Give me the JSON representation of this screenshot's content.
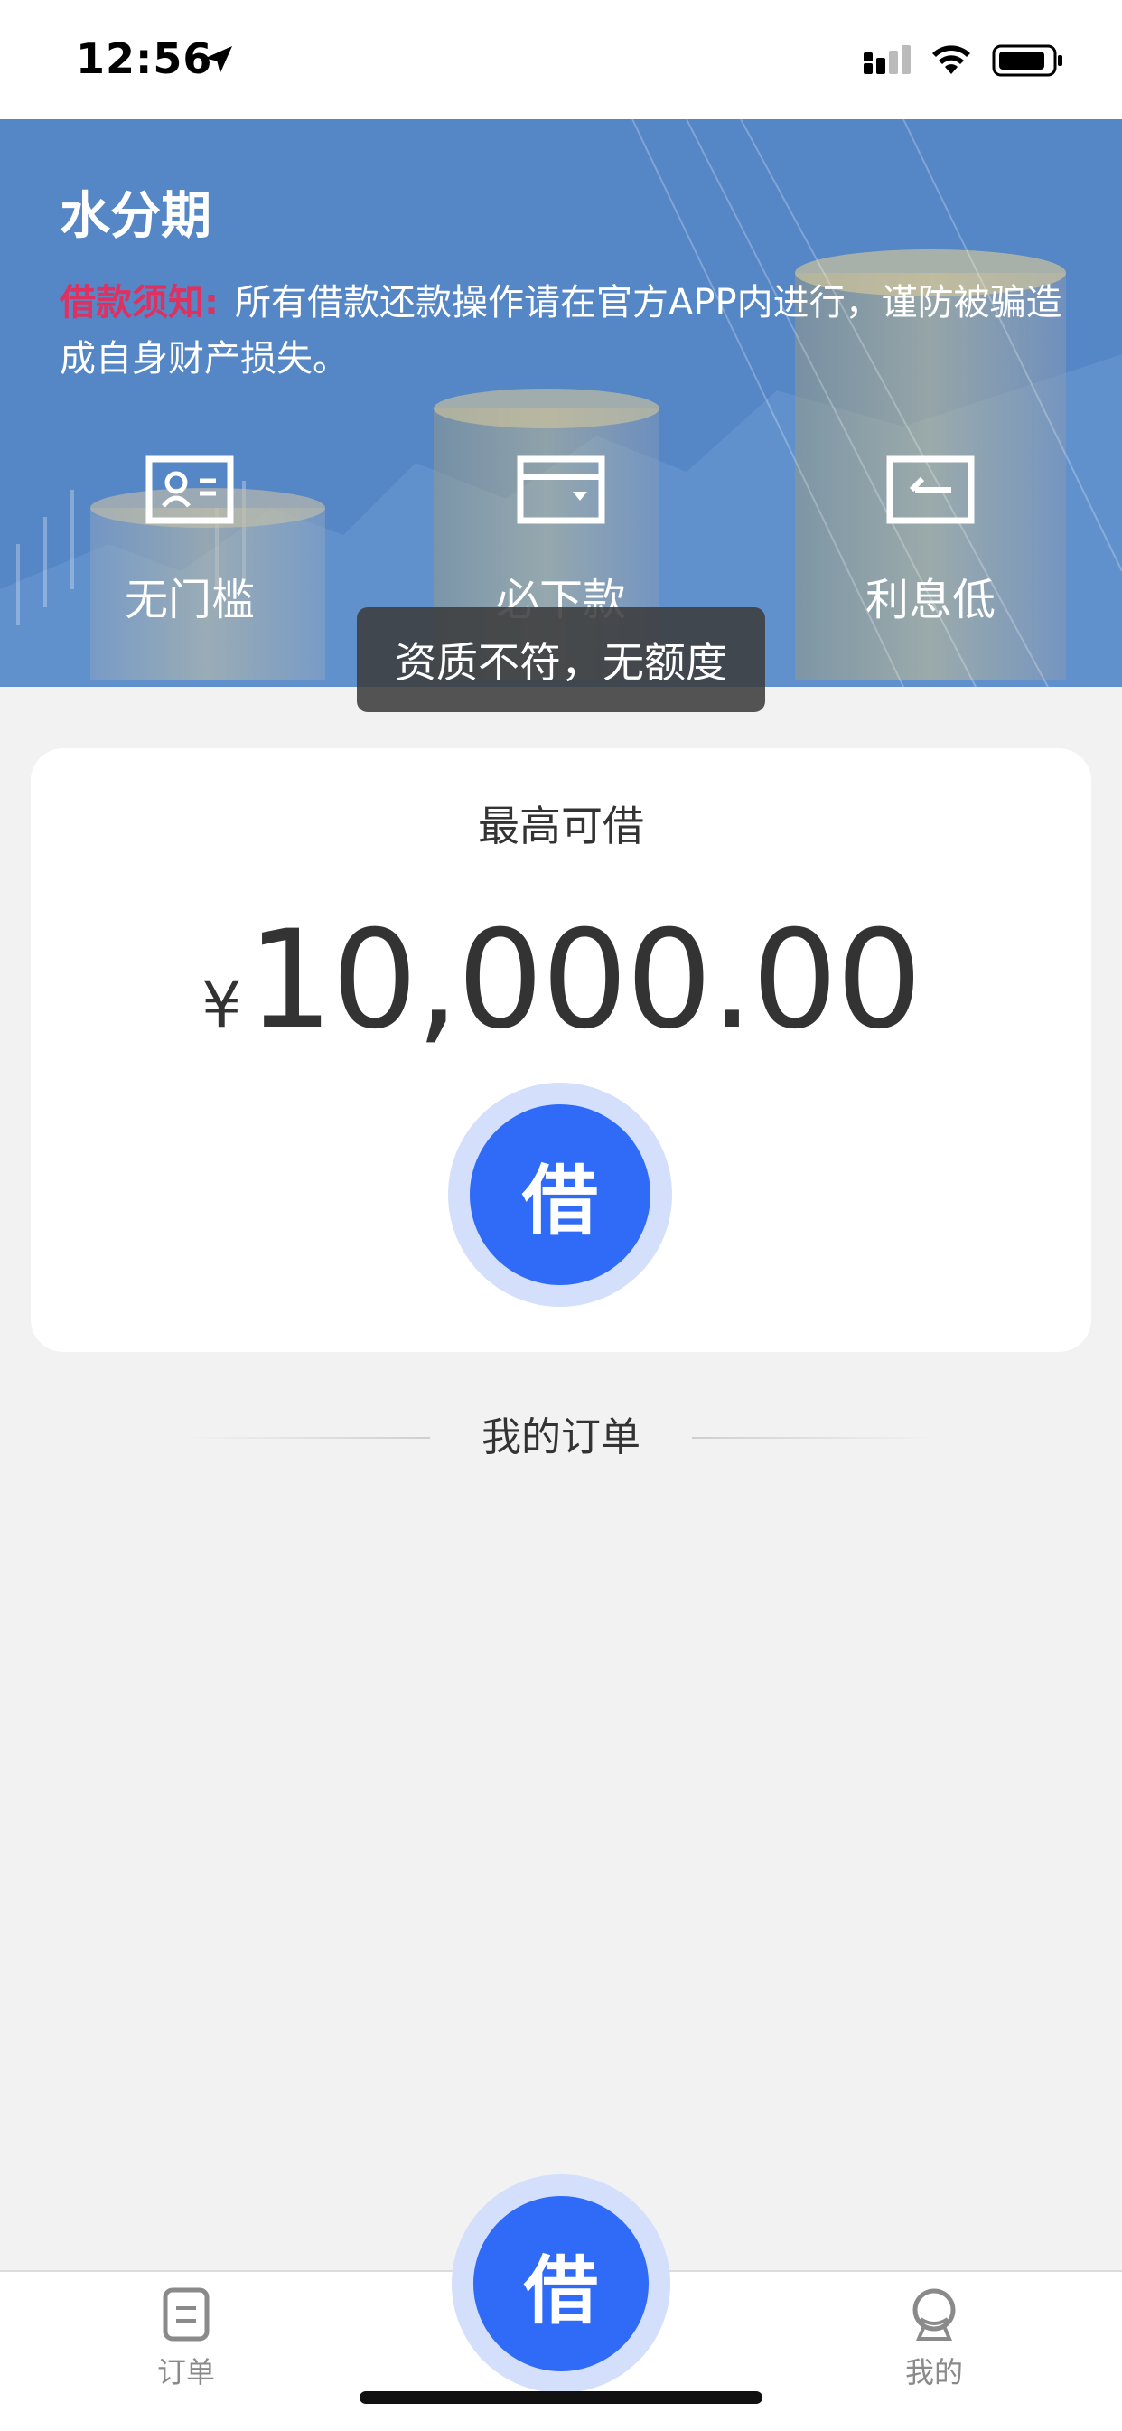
{
  "status_bar": {
    "time": "12:56"
  },
  "hero": {
    "title": "水分期",
    "notice_label": "借款须知:",
    "notice_text": "所有借款还款操作请在官方APP内进行，谨防被骗造成自身财产损失。",
    "features": [
      {
        "label": "无门槛",
        "icon": "id-card-icon"
      },
      {
        "label": "必下款",
        "icon": "wallet-icon"
      },
      {
        "label": "利息低",
        "icon": "return-arrow-icon"
      }
    ]
  },
  "toast": {
    "text": "资质不符，无额度"
  },
  "card": {
    "title": "最高可借",
    "currency": "¥",
    "amount": "10,000.00",
    "borrow_label": "借"
  },
  "orders": {
    "title": "我的订单"
  },
  "tab_bar": {
    "orders_label": "订单",
    "center_label": "借",
    "mine_label": "我的"
  },
  "colors": {
    "accent": "#2f6bf6",
    "notice_label": "#e0305f",
    "hero_blue": "#5c8fcf"
  }
}
